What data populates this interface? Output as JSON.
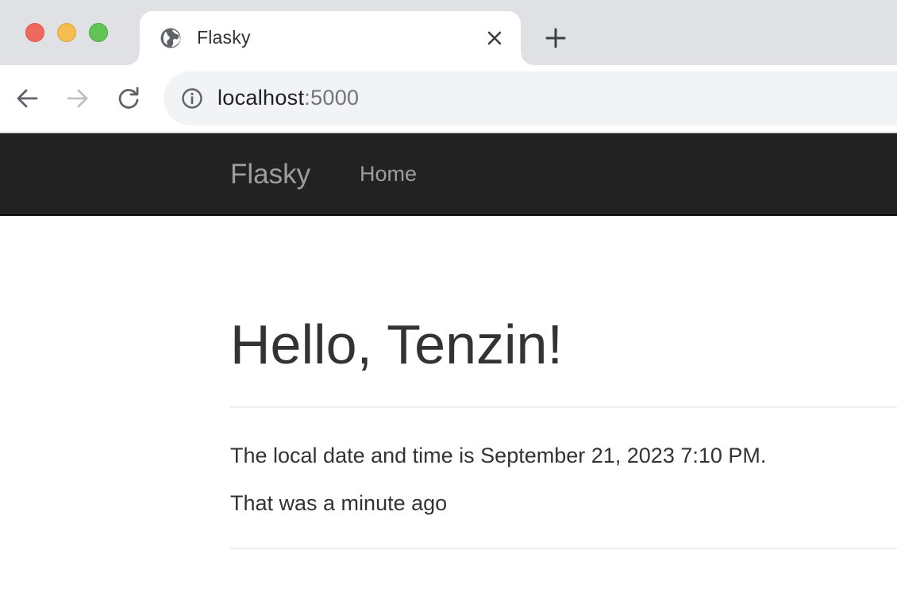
{
  "window": {
    "traffic_lights": [
      "close",
      "minimize",
      "zoom"
    ]
  },
  "tab": {
    "title": "Flasky",
    "favicon_icon": "globe-icon",
    "close_icon": "close-icon"
  },
  "toolbar": {
    "back_icon": "arrow-left-icon",
    "forward_icon": "arrow-right-icon",
    "reload_icon": "reload-icon",
    "url_host": "localhost",
    "url_port": ":5000",
    "info_icon": "info-icon"
  },
  "navbar": {
    "brand": "Flasky",
    "links": [
      "Home"
    ]
  },
  "main": {
    "heading": "Hello, Tenzin!",
    "datetime_text": "The local date and time is September 21, 2023 7:10 PM.",
    "relative_text": "That was a minute ago"
  },
  "colors": {
    "navbar_bg": "#222222",
    "navbar_text": "#9d9d9d",
    "text": "#333333"
  }
}
